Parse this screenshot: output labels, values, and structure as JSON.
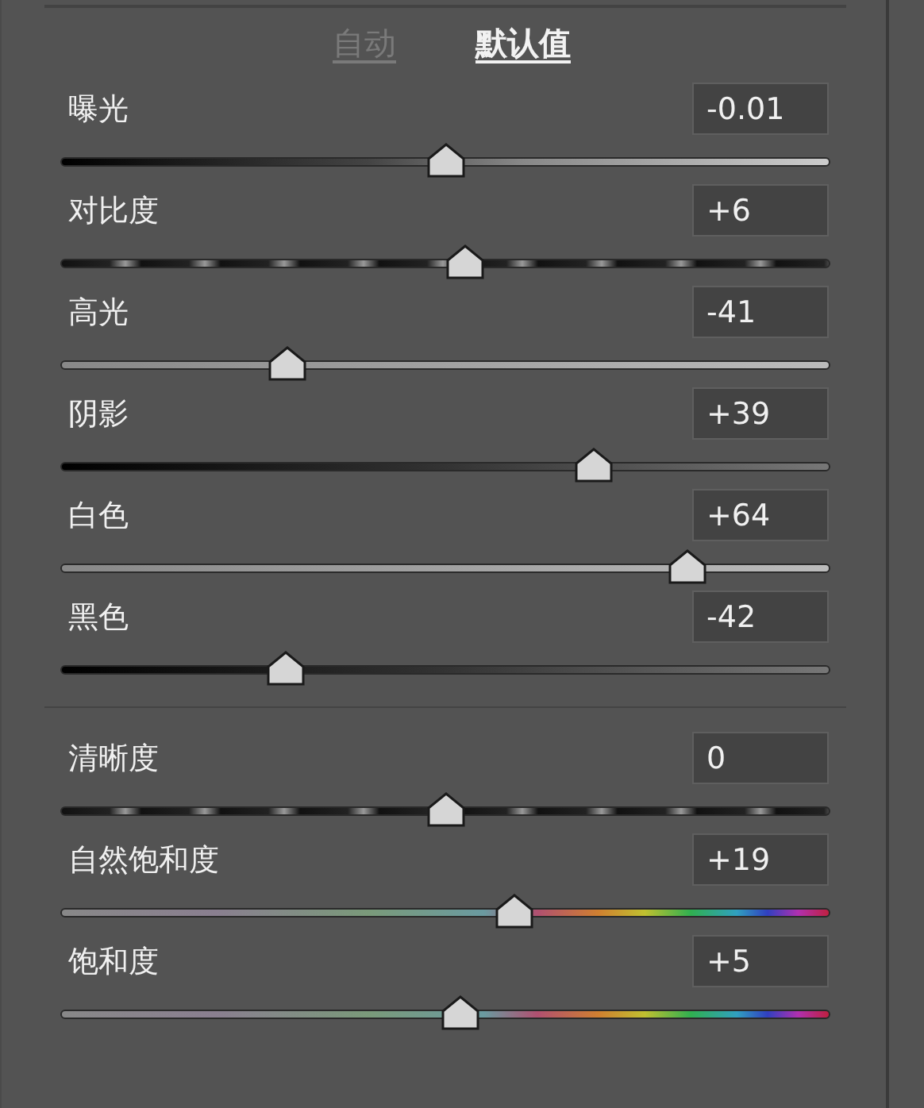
{
  "tabs": [
    {
      "label": "自动",
      "selected": false
    },
    {
      "label": "默认值",
      "selected": true
    }
  ],
  "groups": [
    {
      "sliders": [
        {
          "label": "曝光",
          "value": "-0.01",
          "level": 0.5,
          "kind": "dark-light"
        },
        {
          "label": "对比度",
          "value": "+6",
          "level": 0.526,
          "kind": "stripes"
        },
        {
          "label": "高光",
          "value": "-41",
          "level": 0.295,
          "kind": "light"
        },
        {
          "label": "阴影",
          "value": "+39",
          "level": 0.693,
          "kind": "dark"
        },
        {
          "label": "白色",
          "value": "+64",
          "level": 0.814,
          "kind": "light"
        },
        {
          "label": "黑色",
          "value": "-42",
          "level": 0.293,
          "kind": "dark"
        }
      ]
    },
    {
      "sliders": [
        {
          "label": "清晰度",
          "value": "0",
          "level": 0.5,
          "kind": "stripes"
        },
        {
          "label": "自然饱和度",
          "value": "+19",
          "level": 0.59,
          "kind": "rainbow"
        },
        {
          "label": "饱和度",
          "value": "+5",
          "level": 0.52,
          "kind": "rainbow"
        }
      ]
    }
  ]
}
